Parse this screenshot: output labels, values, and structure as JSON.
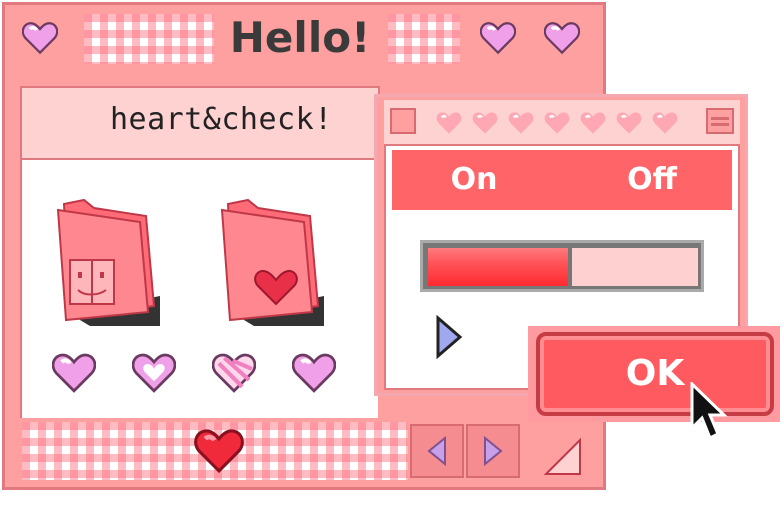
{
  "main_window": {
    "title": "Hello!",
    "header_label": "heart&check!",
    "folders": [
      {
        "name": "finder-folder",
        "icon": "finder-face-icon"
      },
      {
        "name": "heart-folder",
        "icon": "heart-icon"
      }
    ],
    "small_hearts": [
      "heart-icon",
      "heart-outline-icon",
      "heart-striped-icon",
      "heart-icon"
    ]
  },
  "dialog": {
    "toggle": {
      "on_label": "On",
      "off_label": "Off"
    },
    "progress": 0.52,
    "ok_label": "OK"
  },
  "colors": {
    "window_pink": "#fea0a0",
    "accent_red": "#ff5a60",
    "light_pink": "#ffd2d2",
    "heart_pink": "#f090d8"
  }
}
